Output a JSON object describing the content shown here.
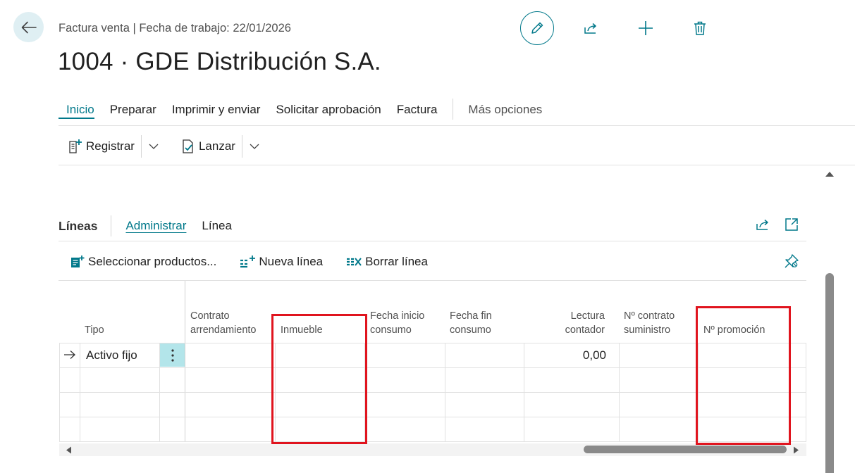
{
  "header": {
    "caption": "Factura venta | Fecha de trabajo: 22/01/2026",
    "title": "1004 · GDE Distribución S.A."
  },
  "tabs": [
    {
      "label": "Inicio"
    },
    {
      "label": "Preparar"
    },
    {
      "label": "Imprimir y enviar"
    },
    {
      "label": "Solicitar aprobación"
    },
    {
      "label": "Factura"
    }
  ],
  "tabs_more": "Más opciones",
  "actions": {
    "registrar": "Registrar",
    "lanzar": "Lanzar"
  },
  "lines": {
    "title": "Líneas",
    "tabs": [
      {
        "label": "Administrar"
      },
      {
        "label": "Línea"
      }
    ],
    "actions": {
      "select_products": "Seleccionar productos...",
      "new_line": "Nueva línea",
      "delete_line": "Borrar línea"
    },
    "columns": {
      "tipo": "Tipo",
      "contrato_1": "Contrato",
      "contrato_2": "arrendamiento",
      "inmueble": "Inmueble",
      "fecha_inicio_1": "Fecha inicio",
      "fecha_inicio_2": "consumo",
      "fecha_fin_1": "Fecha fin",
      "fecha_fin_2": "consumo",
      "lectura_1": "Lectura",
      "lectura_2": "contador",
      "contrato_sum_1": "Nº contrato",
      "contrato_sum_2": "suministro",
      "promocion": "Nº promoción"
    },
    "rows": [
      {
        "tipo": "Activo fijo",
        "lectura": "0,00"
      }
    ]
  },
  "highlight_color": "#e0141e",
  "accent_color": "#00788a"
}
